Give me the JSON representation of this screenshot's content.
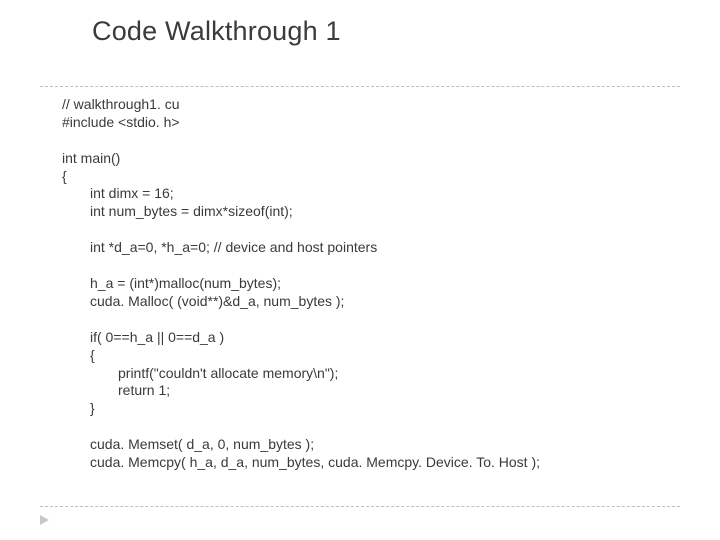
{
  "title": "Code Walkthrough 1",
  "code": {
    "l01": "// walkthrough1. cu",
    "l02": "#include <stdio. h>",
    "l03": "int main()",
    "l04": "{",
    "l05": "int dimx = 16;",
    "l06": "int num_bytes = dimx*sizeof(int);",
    "l07": "int *d_a=0, *h_a=0; // device and host pointers",
    "l08": "h_a = (int*)malloc(num_bytes);",
    "l09": "cuda. Malloc( (void**)&d_a, num_bytes );",
    "l10": "if( 0==h_a || 0==d_a )",
    "l11": "{",
    "l12": "printf(\"couldn't allocate memory\\n\");",
    "l13": "return 1;",
    "l14": "}",
    "l15": "cuda. Memset( d_a, 0, num_bytes );",
    "l16": "cuda. Memcpy( h_a, d_a, num_bytes, cuda. Memcpy. Device. To. Host );"
  }
}
